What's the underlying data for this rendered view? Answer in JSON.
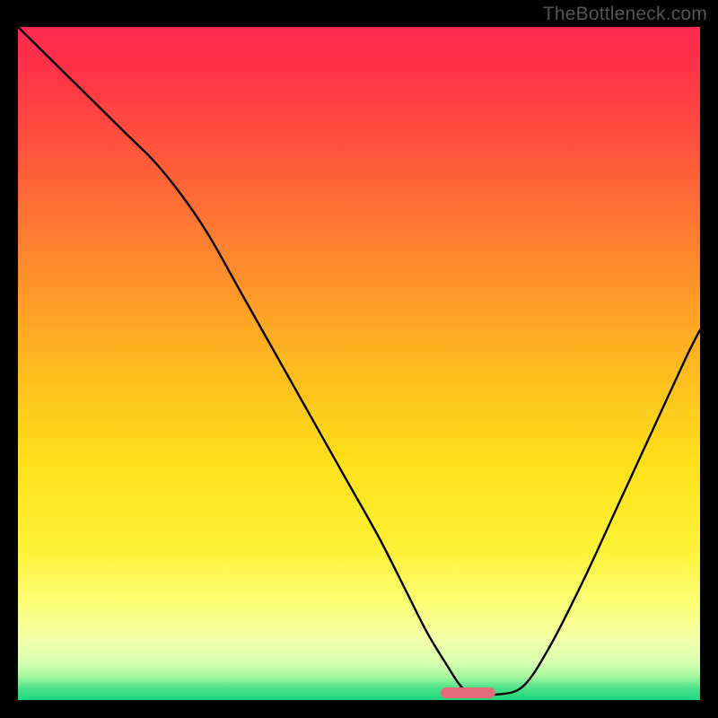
{
  "watermark": "TheBottleneck.com",
  "chart_data": {
    "type": "line",
    "title": "",
    "xlabel": "",
    "ylabel": "",
    "xlim": [
      0,
      100
    ],
    "ylim": [
      0,
      100
    ],
    "background_gradient": {
      "stops": [
        {
          "offset": 0.0,
          "color": "#ff2a4f"
        },
        {
          "offset": 0.07,
          "color": "#ff3347"
        },
        {
          "offset": 0.2,
          "color": "#ff5a3a"
        },
        {
          "offset": 0.35,
          "color": "#ff8a2e"
        },
        {
          "offset": 0.5,
          "color": "#ffb81f"
        },
        {
          "offset": 0.65,
          "color": "#ffe11a"
        },
        {
          "offset": 0.78,
          "color": "#fff23a"
        },
        {
          "offset": 0.86,
          "color": "#fbff7a"
        },
        {
          "offset": 0.91,
          "color": "#f3ffa8"
        },
        {
          "offset": 0.945,
          "color": "#d7ffb0"
        },
        {
          "offset": 0.965,
          "color": "#a7f7a0"
        },
        {
          "offset": 0.982,
          "color": "#4fe28a"
        },
        {
          "offset": 1.0,
          "color": "#1dd67a"
        }
      ]
    },
    "series": [
      {
        "name": "bottleneck-curve",
        "color": "#000000",
        "width": 2.4,
        "x": [
          0,
          4,
          8,
          12,
          16,
          20,
          24,
          28,
          33,
          38,
          43,
          48,
          53,
          57,
          60,
          63,
          65,
          67,
          70,
          74,
          78,
          83,
          88,
          93,
          98,
          100
        ],
        "y": [
          100,
          96,
          92,
          88,
          84,
          80,
          75,
          69,
          60,
          51,
          42,
          33,
          24,
          16,
          10,
          5,
          2,
          0.8,
          0.8,
          2,
          8,
          18,
          29,
          40,
          51,
          55
        ]
      }
    ],
    "marker": {
      "name": "sweet-spot-marker",
      "color": "#e96a7a",
      "x_center": 66.0,
      "x_halfwidth": 3.2,
      "y": 0.0,
      "thickness": 1.6,
      "cap": "round"
    }
  }
}
